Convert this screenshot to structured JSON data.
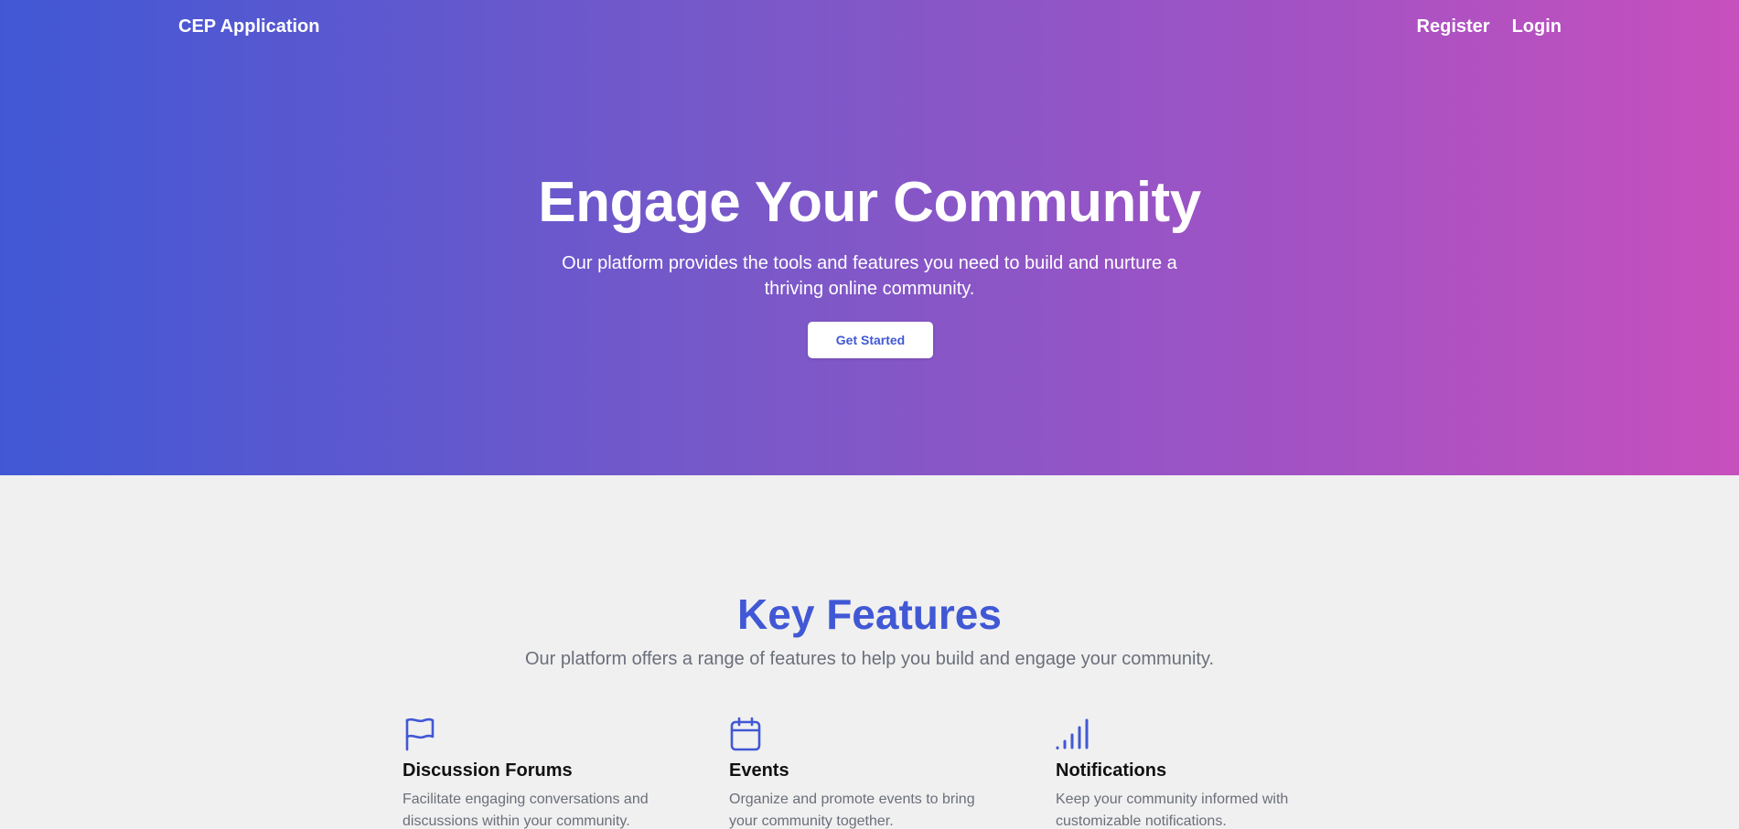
{
  "header": {
    "brand": "CEP Application",
    "nav": {
      "register": "Register",
      "login": "Login"
    }
  },
  "hero": {
    "title": "Engage Your Community",
    "subtitle": "Our platform provides the tools and features you need to build and nurture a thriving online community.",
    "cta_label": "Get Started",
    "gradient_colors": [
      "#4158d5",
      "#c750bd"
    ]
  },
  "features": {
    "title": "Key Features",
    "subtitle": "Our platform offers a range of features to help you build and engage your community.",
    "accent_color": "#4158d5",
    "items": [
      {
        "icon": "flag-icon",
        "title": "Discussion Forums",
        "description": "Facilitate engaging conversations and discussions within your community."
      },
      {
        "icon": "calendar-icon",
        "title": "Events",
        "description": "Organize and promote events to bring your community together."
      },
      {
        "icon": "signal-bars-icon",
        "title": "Notifications",
        "description": "Keep your community informed with customizable notifications."
      }
    ]
  }
}
